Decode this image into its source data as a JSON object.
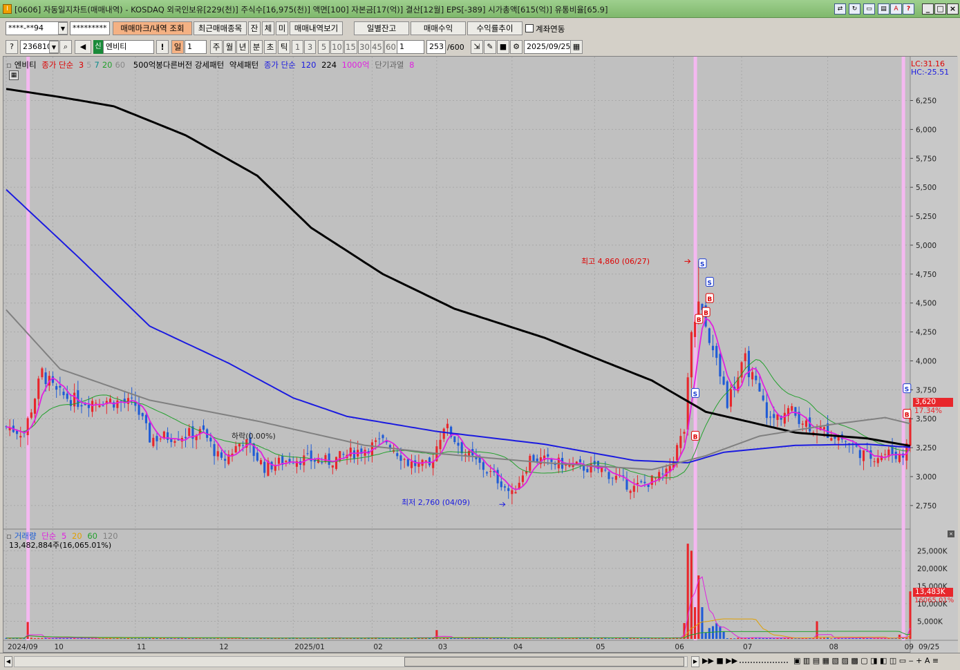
{
  "window": {
    "code": "[0606]",
    "title_text": "[0606] 자동일지차트(매매내역) - KOSDAQ 외국인보유[229(천)] 주식수[16,975(천)] 액면[100] 자본금[17(억)] 결산[12월] EPS[-389] 시가총액[615(억)] 유통비율[65.9]"
  },
  "toolbar1": {
    "account_value": "****-**94",
    "password_value": "*********",
    "btn_trade_mark": "매매마크/내역 조회",
    "btn_recent": "최근매매종목",
    "btn_jan": "잔",
    "btn_che": "체",
    "btn_mi": "미",
    "btn_history": "매매내역보기",
    "btn_daily": "일별잔고",
    "btn_profit": "매매수익",
    "btn_return": "수익률추이",
    "chk_link_label": "계좌연동"
  },
  "toolbar2": {
    "code_value": "236810",
    "name_badge": "신",
    "name_value": "엔비티",
    "period_day": "일",
    "period_count": "1",
    "period_week": "주",
    "period_month": "월",
    "period_year": "년",
    "period_min": "분",
    "period_sec": "초",
    "period_tick": "틱",
    "intervals": [
      "1",
      "3",
      "5",
      "10",
      "15",
      "30",
      "45",
      "60"
    ],
    "custom_interval": "1",
    "count_value": "253",
    "count_max": "/600",
    "date_value": "2025/09/25"
  },
  "chart_legend": {
    "name": "엔비티",
    "ma_label": "종가 단순",
    "ma_periods": [
      "3",
      "5",
      "7",
      "20",
      "60"
    ],
    "pattern1": "500억봉다른버전 강세패턴",
    "pattern2": "약세패턴",
    "ma2_label": "종가 단순",
    "ma2_periods": [
      "120",
      "224"
    ],
    "ind_1000": "1000억",
    "short_over_label": "단기과열",
    "short_over_val": "8",
    "lc": "LC:31.16",
    "hc": "HC:-25.51"
  },
  "annotations": {
    "high": "최고 4,860 (06/27)",
    "low": "최저 2,760 (04/09)",
    "mid_label": "하락(0.00%)",
    "last_price": "3,620",
    "last_pct": "17.34%"
  },
  "volume_legend": {
    "label": "거래량",
    "ma_label": "단순",
    "periods": [
      "5",
      "20",
      "60",
      "120"
    ],
    "total": "13,482,884주(16,065.01%)",
    "last_vol": "13,483K",
    "last_pct": "16065.01%"
  },
  "colors": {
    "up": "#e8262b",
    "down": "#1f5bd6",
    "ma120": "#1a1ae0",
    "ma224": "#000000",
    "ma_gray": "#808080",
    "ma_magenta": "#e020e0",
    "ma_green": "#22a02c",
    "background": "#c0c0c0"
  },
  "chart_data": {
    "type": "line",
    "title": "",
    "x_ticks": [
      "2024/09",
      "10",
      "11",
      "12",
      "2025/01",
      "02",
      "03",
      "04",
      "05",
      "06",
      "07",
      "08",
      "09",
      "09/25"
    ],
    "y_ticks": [
      2750,
      3000,
      3250,
      3500,
      3750,
      4000,
      4250,
      4500,
      4750,
      5000,
      5250,
      5500,
      5750,
      6000,
      6250
    ],
    "ylim": [
      2600,
      6450
    ],
    "vol_ticks": [
      "5,000K",
      "10,000K",
      "15,000K",
      "20,000K",
      "25,000K"
    ],
    "vol_ylim": [
      0,
      28000
    ],
    "series": [
      {
        "name": "224",
        "color": "#000000",
        "points": [
          [
            0,
            6350
          ],
          [
            15,
            6280
          ],
          [
            30,
            6200
          ],
          [
            50,
            5950
          ],
          [
            70,
            5600
          ],
          [
            85,
            5150
          ],
          [
            105,
            4750
          ],
          [
            125,
            4450
          ],
          [
            150,
            4200
          ],
          [
            180,
            3830
          ],
          [
            195,
            3560
          ],
          [
            220,
            3380
          ],
          [
            240,
            3330
          ],
          [
            253,
            3260
          ]
        ]
      },
      {
        "name": "120",
        "color": "#1a1ae0",
        "points": [
          [
            0,
            5480
          ],
          [
            20,
            4900
          ],
          [
            40,
            4300
          ],
          [
            62,
            3980
          ],
          [
            80,
            3680
          ],
          [
            95,
            3520
          ],
          [
            120,
            3390
          ],
          [
            150,
            3280
          ],
          [
            175,
            3140
          ],
          [
            190,
            3120
          ],
          [
            200,
            3210
          ],
          [
            220,
            3270
          ],
          [
            240,
            3280
          ],
          [
            253,
            3250
          ]
        ]
      },
      {
        "name": "60",
        "color": "#808080",
        "points": [
          [
            0,
            4440
          ],
          [
            15,
            3930
          ],
          [
            40,
            3660
          ],
          [
            70,
            3480
          ],
          [
            100,
            3270
          ],
          [
            120,
            3200
          ],
          [
            150,
            3120
          ],
          [
            180,
            3060
          ],
          [
            195,
            3180
          ],
          [
            210,
            3350
          ],
          [
            230,
            3450
          ],
          [
            245,
            3510
          ],
          [
            253,
            3450
          ]
        ]
      }
    ],
    "price_summary": {
      "high": 4860,
      "high_date": "06/27",
      "low": 2760,
      "low_date": "04/09",
      "last": 3620
    }
  }
}
